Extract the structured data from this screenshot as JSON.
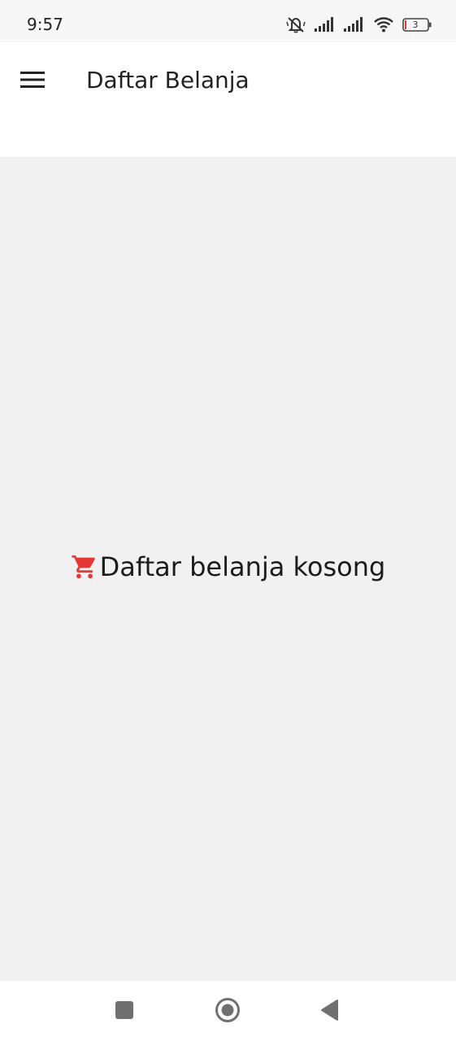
{
  "status_bar": {
    "time": "9:57",
    "battery_level": "3",
    "icons": [
      "bell-muted-icon",
      "signal-icon",
      "signal-icon",
      "wifi-icon",
      "battery-icon"
    ]
  },
  "app_bar": {
    "title": "Daftar Belanja",
    "menu_icon": "hamburger-menu-icon"
  },
  "empty_state": {
    "icon": "shopping-cart-icon",
    "icon_color": "#e53935",
    "message": "Daftar belanja kosong"
  },
  "nav_bar": {
    "buttons": [
      "recents-icon",
      "home-icon",
      "back-icon"
    ]
  }
}
